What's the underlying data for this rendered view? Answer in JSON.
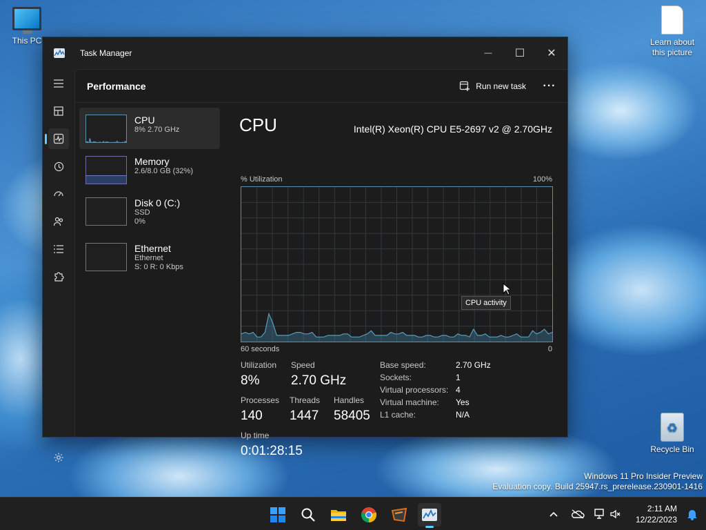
{
  "desktop": {
    "icons": {
      "this_pc": "This PC",
      "learn": "Learn about this picture",
      "recycle": "Recycle Bin"
    },
    "watermark_line1": "Windows 11 Pro Insider Preview",
    "watermark_line2": "Evaluation copy. Build 25947.rs_prerelease.230901-1416"
  },
  "window": {
    "title": "Task Manager",
    "controls": {
      "minimize": "—",
      "maximize": "☐",
      "close": "✕"
    }
  },
  "header": {
    "page_title": "Performance",
    "run_new_task": "Run new task",
    "more": "···"
  },
  "resources": [
    {
      "name": "CPU",
      "sub1": "8%  2.70 GHz",
      "sub2": "",
      "sub3": ""
    },
    {
      "name": "Memory",
      "sub1": "2.6/8.0 GB (32%)",
      "sub2": "",
      "sub3": ""
    },
    {
      "name": "Disk 0 (C:)",
      "sub1": "SSD",
      "sub2": "0%",
      "sub3": ""
    },
    {
      "name": "Ethernet",
      "sub1": "Ethernet",
      "sub2": "S: 0  R: 0 Kbps",
      "sub3": ""
    }
  ],
  "detail": {
    "title": "CPU",
    "model": "Intel(R) Xeon(R) CPU E5-2697 v2 @ 2.70GHz",
    "graph_top_left": "% Utilization",
    "graph_top_right": "100%",
    "graph_bottom_left": "60 seconds",
    "graph_bottom_right": "0",
    "tooltip": "CPU activity",
    "stats": {
      "utilization_label": "Utilization",
      "utilization": "8%",
      "speed_label": "Speed",
      "speed": "2.70 GHz",
      "processes_label": "Processes",
      "processes": "140",
      "threads_label": "Threads",
      "threads": "1447",
      "handles_label": "Handles",
      "handles": "58405",
      "uptime_label": "Up time",
      "uptime": "0:01:28:15"
    },
    "specs": [
      {
        "k": "Base speed:",
        "v": "2.70 GHz"
      },
      {
        "k": "Sockets:",
        "v": "1"
      },
      {
        "k": "Virtual processors:",
        "v": "4"
      },
      {
        "k": "Virtual machine:",
        "v": "Yes"
      },
      {
        "k": "L1 cache:",
        "v": "N/A"
      }
    ],
    "cpu_series": [
      5,
      6,
      5,
      6,
      3,
      3,
      6,
      18,
      12,
      4,
      4,
      4,
      4,
      5,
      6,
      6,
      5,
      5,
      6,
      3,
      3,
      3,
      4,
      4,
      4,
      4,
      5,
      5,
      3,
      3,
      3,
      4,
      5,
      7,
      4,
      4,
      4,
      4,
      6,
      5,
      5,
      6,
      4,
      4,
      4,
      3,
      3,
      4,
      4,
      3,
      3,
      4,
      4,
      3,
      3,
      5,
      4,
      4,
      3,
      8,
      4,
      4,
      5,
      3,
      3,
      3,
      4,
      3,
      3,
      4,
      5,
      3,
      3,
      3,
      7,
      5,
      6,
      8,
      5,
      6
    ]
  },
  "taskbar": {
    "clock_time": "2:11 AM",
    "clock_date": "12/22/2023"
  },
  "colors": {
    "accent": "#60cdff",
    "graph_line": "#5c9bbd"
  }
}
